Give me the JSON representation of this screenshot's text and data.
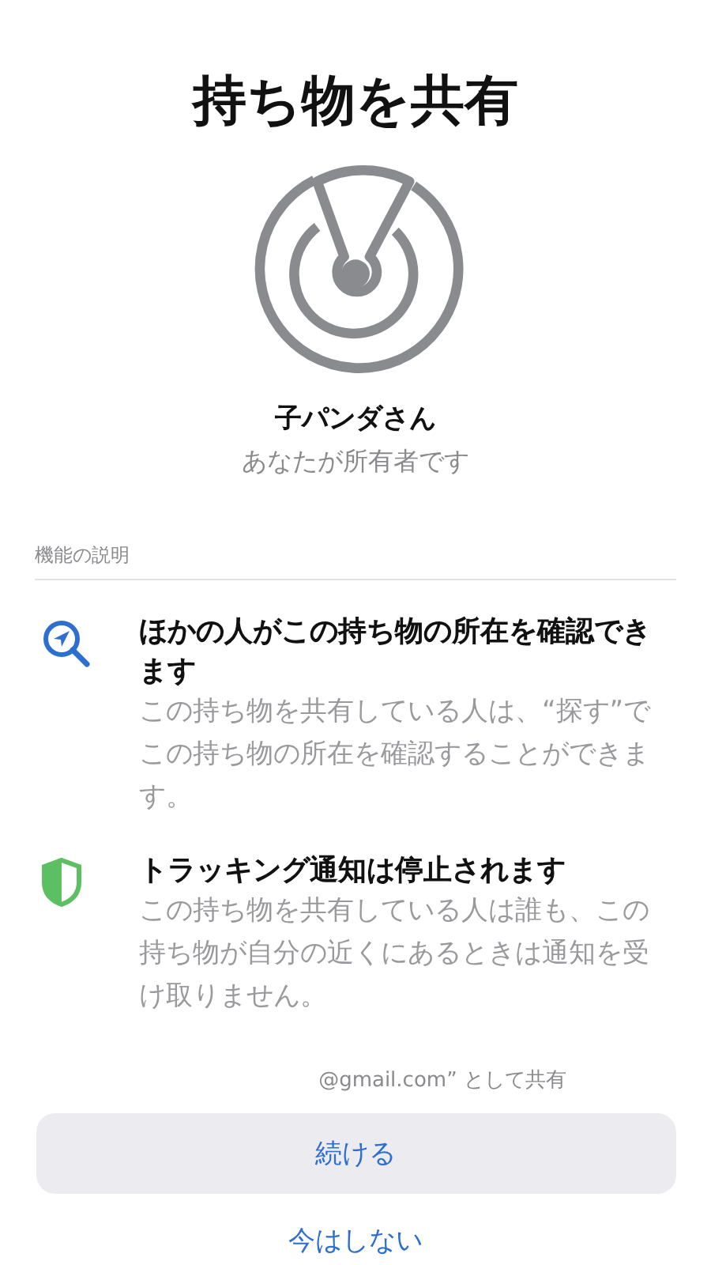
{
  "title": "持ち物を共有",
  "item": {
    "name": "子パンダさん",
    "owner": "あなたが所有者です"
  },
  "section": {
    "label": "機能の説明",
    "features": [
      {
        "kind": "locate",
        "title": "ほかの人がこの持ち物の所在を確認できます",
        "description": "この持ち物を共有している人は、“探す”でこの持ち物の所在を確認することができます。"
      },
      {
        "kind": "shield",
        "title": "トラッキング通知は停止されます",
        "description": "この持ち物を共有している人は誰も、この持ち物が自分の近くにあるときは通知を受け取りません。"
      }
    ]
  },
  "share_as": "@gmail.com” として共有",
  "buttons": {
    "primary": "続ける",
    "secondary": "今はしない"
  }
}
